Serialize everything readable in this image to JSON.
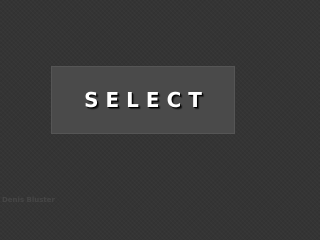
{
  "button": {
    "label": "SELECT"
  },
  "watermark": {
    "text": "Denis Bluster"
  },
  "colors": {
    "background": "#343434",
    "button_background": "#4a4a4a",
    "button_text": "#ffffff",
    "watermark_text": "#454545"
  }
}
